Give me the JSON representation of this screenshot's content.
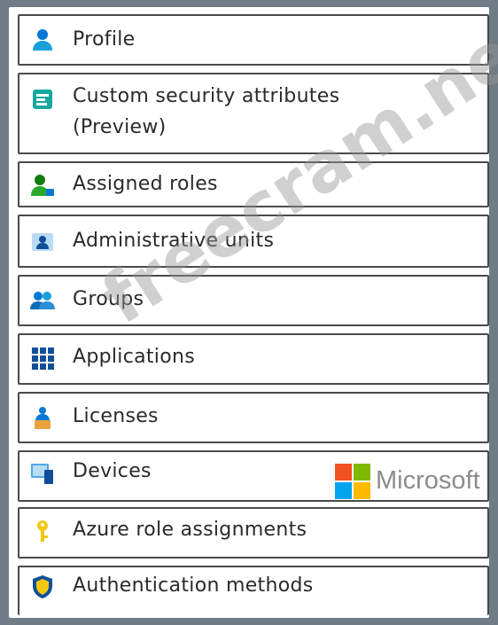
{
  "menu": {
    "items": [
      {
        "label": "Profile",
        "icon": "user-icon"
      },
      {
        "label": "Custom security attributes",
        "label2": "(Preview)",
        "icon": "attributes-icon"
      },
      {
        "label": "Assigned roles",
        "icon": "assigned-roles-icon"
      },
      {
        "label": "Administrative units",
        "icon": "administrative-units-icon"
      },
      {
        "label": "Groups",
        "icon": "groups-icon"
      },
      {
        "label": "Applications",
        "icon": "applications-grid-icon"
      },
      {
        "label": "Licenses",
        "icon": "licenses-icon"
      },
      {
        "label": "Devices",
        "icon": "devices-icon"
      },
      {
        "label": "Azure role assignments",
        "icon": "key-icon"
      },
      {
        "label": "Authentication methods",
        "icon": "shield-icon"
      }
    ]
  },
  "watermark": "freecram.net",
  "brand": {
    "name": "Microsoft",
    "logo_colors": [
      "#f25022",
      "#7fba00",
      "#00a4ef",
      "#ffb900"
    ]
  },
  "colors": {
    "icon_blue": "#0078d4",
    "icon_teal": "#13a89e",
    "icon_green": "#107c10",
    "icon_yellow": "#f2c811"
  }
}
